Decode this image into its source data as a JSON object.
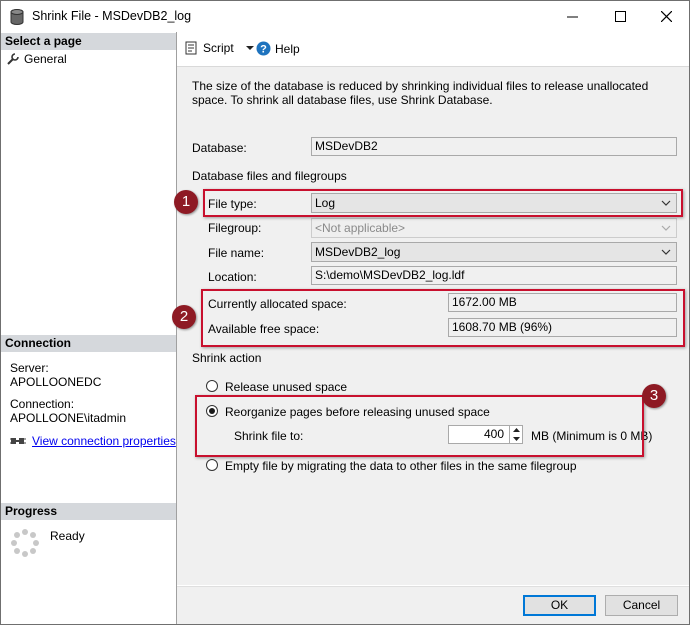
{
  "window": {
    "title": "Shrink File - MSDevDB2_log",
    "minimize": "—",
    "maximize": "☐",
    "close": "✕"
  },
  "left_pane": {
    "select_page_header": "Select a page",
    "pages": [
      {
        "label": "General",
        "icon": "wrench-icon"
      }
    ],
    "connection_header": "Connection",
    "server_label": "Server:",
    "server_value": "APOLLOONEDC",
    "connection_label": "Connection:",
    "connection_value": "APOLLOONE\\itadmin",
    "view_connection_link": "View connection properties",
    "progress_header": "Progress",
    "progress_status": "Ready"
  },
  "toolbar": {
    "script_label": "Script",
    "help_label": "Help"
  },
  "content": {
    "description": "The size of the database is reduced by shrinking individual files to release unallocated space. To shrink all database files, use Shrink Database.",
    "database_label": "Database:",
    "database_value": "MSDevDB2",
    "files_group_label": "Database files and filegroups",
    "file_type_label": "File type:",
    "file_type_value": "Log",
    "filegroup_label": "Filegroup:",
    "filegroup_value": "<Not applicable>",
    "file_name_label": "File name:",
    "file_name_value": "MSDevDB2_log",
    "location_label": "Location:",
    "location_value": "S:\\demo\\MSDevDB2_log.ldf",
    "allocated_label": "Currently allocated space:",
    "allocated_value": "1672.00 MB",
    "free_label": "Available free space:",
    "free_value": "1608.70 MB (96%)",
    "shrink_action_label": "Shrink action",
    "option_release": "Release unused space",
    "option_reorganize": "Reorganize pages before releasing unused space",
    "shrink_to_label": "Shrink file to:",
    "shrink_to_value": "400",
    "shrink_to_unit": "MB (Minimum is 0 MB)",
    "option_empty": "Empty file by migrating the data to other files in the same filegroup",
    "selected_option": "reorganize"
  },
  "annotations": {
    "badge1": "1",
    "badge2": "2",
    "badge3": "3",
    "color": "#c8102e"
  },
  "footer": {
    "ok_label": "OK",
    "cancel_label": "Cancel"
  }
}
